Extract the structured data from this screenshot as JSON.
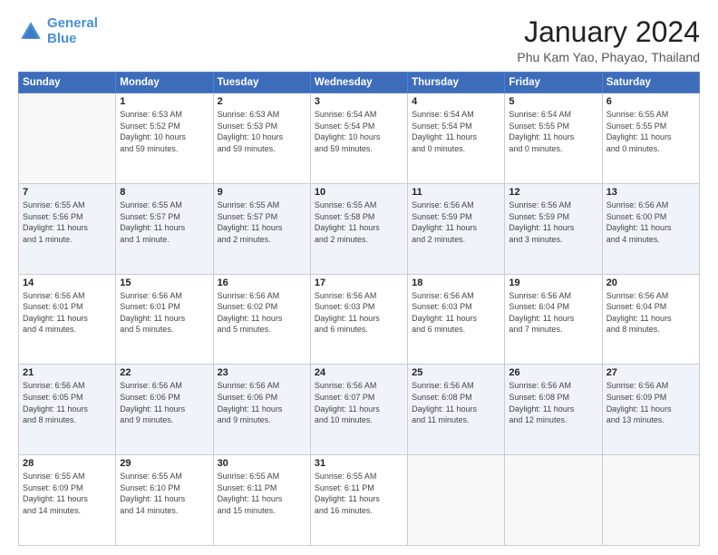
{
  "header": {
    "logo_line1": "General",
    "logo_line2": "Blue",
    "month_year": "January 2024",
    "location": "Phu Kam Yao, Phayao, Thailand"
  },
  "weekdays": [
    "Sunday",
    "Monday",
    "Tuesday",
    "Wednesday",
    "Thursday",
    "Friday",
    "Saturday"
  ],
  "weeks": [
    [
      {
        "day": "",
        "info": ""
      },
      {
        "day": "1",
        "info": "Sunrise: 6:53 AM\nSunset: 5:52 PM\nDaylight: 10 hours\nand 59 minutes."
      },
      {
        "day": "2",
        "info": "Sunrise: 6:53 AM\nSunset: 5:53 PM\nDaylight: 10 hours\nand 59 minutes."
      },
      {
        "day": "3",
        "info": "Sunrise: 6:54 AM\nSunset: 5:54 PM\nDaylight: 10 hours\nand 59 minutes."
      },
      {
        "day": "4",
        "info": "Sunrise: 6:54 AM\nSunset: 5:54 PM\nDaylight: 11 hours\nand 0 minutes."
      },
      {
        "day": "5",
        "info": "Sunrise: 6:54 AM\nSunset: 5:55 PM\nDaylight: 11 hours\nand 0 minutes."
      },
      {
        "day": "6",
        "info": "Sunrise: 6:55 AM\nSunset: 5:55 PM\nDaylight: 11 hours\nand 0 minutes."
      }
    ],
    [
      {
        "day": "7",
        "info": "Sunrise: 6:55 AM\nSunset: 5:56 PM\nDaylight: 11 hours\nand 1 minute."
      },
      {
        "day": "8",
        "info": "Sunrise: 6:55 AM\nSunset: 5:57 PM\nDaylight: 11 hours\nand 1 minute."
      },
      {
        "day": "9",
        "info": "Sunrise: 6:55 AM\nSunset: 5:57 PM\nDaylight: 11 hours\nand 2 minutes."
      },
      {
        "day": "10",
        "info": "Sunrise: 6:55 AM\nSunset: 5:58 PM\nDaylight: 11 hours\nand 2 minutes."
      },
      {
        "day": "11",
        "info": "Sunrise: 6:56 AM\nSunset: 5:59 PM\nDaylight: 11 hours\nand 2 minutes."
      },
      {
        "day": "12",
        "info": "Sunrise: 6:56 AM\nSunset: 5:59 PM\nDaylight: 11 hours\nand 3 minutes."
      },
      {
        "day": "13",
        "info": "Sunrise: 6:56 AM\nSunset: 6:00 PM\nDaylight: 11 hours\nand 4 minutes."
      }
    ],
    [
      {
        "day": "14",
        "info": "Sunrise: 6:56 AM\nSunset: 6:01 PM\nDaylight: 11 hours\nand 4 minutes."
      },
      {
        "day": "15",
        "info": "Sunrise: 6:56 AM\nSunset: 6:01 PM\nDaylight: 11 hours\nand 5 minutes."
      },
      {
        "day": "16",
        "info": "Sunrise: 6:56 AM\nSunset: 6:02 PM\nDaylight: 11 hours\nand 5 minutes."
      },
      {
        "day": "17",
        "info": "Sunrise: 6:56 AM\nSunset: 6:03 PM\nDaylight: 11 hours\nand 6 minutes."
      },
      {
        "day": "18",
        "info": "Sunrise: 6:56 AM\nSunset: 6:03 PM\nDaylight: 11 hours\nand 6 minutes."
      },
      {
        "day": "19",
        "info": "Sunrise: 6:56 AM\nSunset: 6:04 PM\nDaylight: 11 hours\nand 7 minutes."
      },
      {
        "day": "20",
        "info": "Sunrise: 6:56 AM\nSunset: 6:04 PM\nDaylight: 11 hours\nand 8 minutes."
      }
    ],
    [
      {
        "day": "21",
        "info": "Sunrise: 6:56 AM\nSunset: 6:05 PM\nDaylight: 11 hours\nand 8 minutes."
      },
      {
        "day": "22",
        "info": "Sunrise: 6:56 AM\nSunset: 6:06 PM\nDaylight: 11 hours\nand 9 minutes."
      },
      {
        "day": "23",
        "info": "Sunrise: 6:56 AM\nSunset: 6:06 PM\nDaylight: 11 hours\nand 9 minutes."
      },
      {
        "day": "24",
        "info": "Sunrise: 6:56 AM\nSunset: 6:07 PM\nDaylight: 11 hours\nand 10 minutes."
      },
      {
        "day": "25",
        "info": "Sunrise: 6:56 AM\nSunset: 6:08 PM\nDaylight: 11 hours\nand 11 minutes."
      },
      {
        "day": "26",
        "info": "Sunrise: 6:56 AM\nSunset: 6:08 PM\nDaylight: 11 hours\nand 12 minutes."
      },
      {
        "day": "27",
        "info": "Sunrise: 6:56 AM\nSunset: 6:09 PM\nDaylight: 11 hours\nand 13 minutes."
      }
    ],
    [
      {
        "day": "28",
        "info": "Sunrise: 6:55 AM\nSunset: 6:09 PM\nDaylight: 11 hours\nand 14 minutes."
      },
      {
        "day": "29",
        "info": "Sunrise: 6:55 AM\nSunset: 6:10 PM\nDaylight: 11 hours\nand 14 minutes."
      },
      {
        "day": "30",
        "info": "Sunrise: 6:55 AM\nSunset: 6:11 PM\nDaylight: 11 hours\nand 15 minutes."
      },
      {
        "day": "31",
        "info": "Sunrise: 6:55 AM\nSunset: 6:11 PM\nDaylight: 11 hours\nand 16 minutes."
      },
      {
        "day": "",
        "info": ""
      },
      {
        "day": "",
        "info": ""
      },
      {
        "day": "",
        "info": ""
      }
    ]
  ]
}
